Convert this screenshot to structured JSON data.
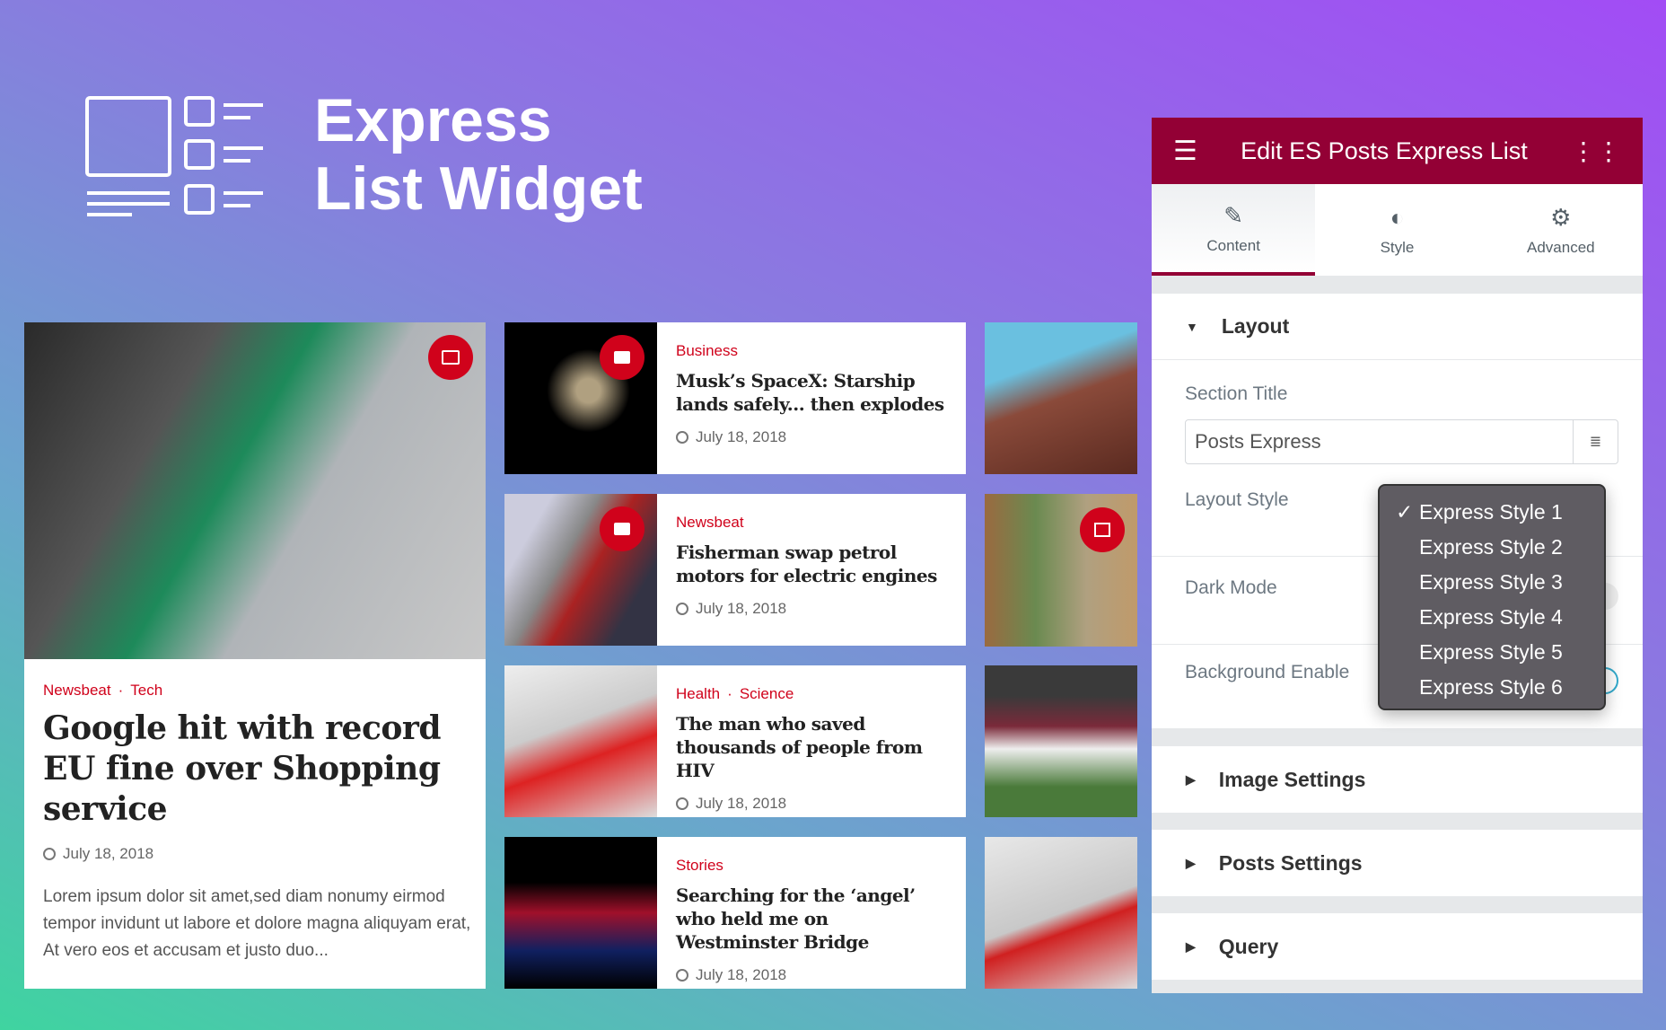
{
  "hero": {
    "title_line1": "Express",
    "title_line2": "List Widget"
  },
  "featured": {
    "categories": [
      "Newsbeat",
      "Tech"
    ],
    "title": "Google hit with record EU fine over Shopping service",
    "date": "July 18, 2018",
    "excerpt": "Lorem ipsum dolor sit amet,sed diam nonumy eirmod tempor invidunt ut labore et dolore magna aliquyam erat, At vero eos et accusam et justo duo...",
    "badge_icon": "image-icon"
  },
  "posts": [
    {
      "categories": [
        "Business"
      ],
      "title": "Musk’s SpaceX: Starship lands safely... then explodes",
      "date": "July 18, 2018",
      "badge_icon": "video-icon"
    },
    {
      "categories": [
        "Newsbeat"
      ],
      "title": "Fisherman swap petrol motors for electric engines",
      "date": "July 18, 2018",
      "badge_icon": "video-icon"
    },
    {
      "categories": [
        "Health",
        "Science"
      ],
      "title": "The man who saved thousands of people from HIV",
      "date": "July 18, 2018"
    },
    {
      "categories": [
        "Stories"
      ],
      "title": "Searching for the ‘angel’ who held me on Westminster Bridge",
      "date": "July 18, 2018"
    }
  ],
  "panel": {
    "title": "Edit ES Posts Express List",
    "tabs": [
      {
        "label": "Content",
        "icon": "pencil-icon"
      },
      {
        "label": "Style",
        "icon": "contrast-icon"
      },
      {
        "label": "Advanced",
        "icon": "gear-icon"
      }
    ],
    "layout": {
      "heading": "Layout",
      "section_title_label": "Section Title",
      "section_title_value": "Posts Express",
      "layout_style_label": "Layout Style",
      "dark_mode_label": "Dark Mode",
      "background_label": "Background Enable"
    },
    "layout_options": [
      "Express Style 1",
      "Express Style 2",
      "Express Style 3",
      "Express Style 4",
      "Express Style 5",
      "Express Style 6"
    ],
    "selected_option": "Express Style 1",
    "sections": [
      "Image Settings",
      "Posts Settings",
      "Query"
    ]
  },
  "colors": {
    "accent": "#d0021b",
    "panel_header": "#930035"
  }
}
